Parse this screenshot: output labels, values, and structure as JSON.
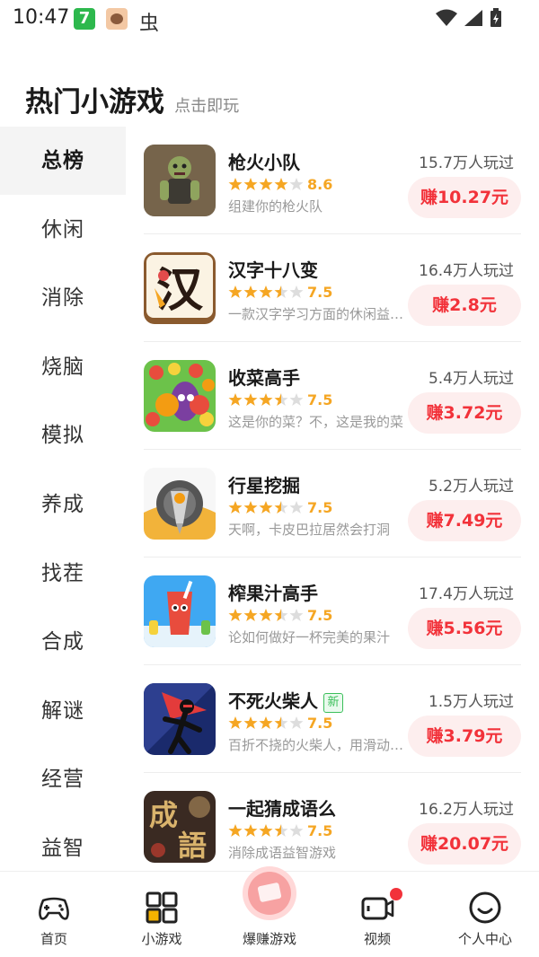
{
  "status_bar": {
    "time": "10:47",
    "app1_glyph": "7",
    "app3_glyph": "虫"
  },
  "header": {
    "title": "热门小游戏",
    "subtitle": "点击即玩"
  },
  "sidebar": {
    "items": [
      {
        "label": "总榜",
        "active": true
      },
      {
        "label": "休闲"
      },
      {
        "label": "消除"
      },
      {
        "label": "烧脑"
      },
      {
        "label": "模拟"
      },
      {
        "label": "养成"
      },
      {
        "label": "找茬"
      },
      {
        "label": "合成"
      },
      {
        "label": "解谜"
      },
      {
        "label": "经营"
      },
      {
        "label": "益智"
      }
    ]
  },
  "games": [
    {
      "name": "枪火小队",
      "rating": "8.6",
      "stars": 4,
      "desc": "组建你的枪火队",
      "plays": "15.7万人玩过",
      "earn": "赚10.27元",
      "is_new": false,
      "icon": "zombie-icon"
    },
    {
      "name": "汉字十八变",
      "rating": "7.5",
      "stars": 3.5,
      "desc": "一款汉字学习方面的休闲益智游戏",
      "plays": "16.4万人玩过",
      "earn": "赚2.8元",
      "is_new": false,
      "icon": "hanzi-icon",
      "icon_char": "汉"
    },
    {
      "name": "收菜高手",
      "rating": "7.5",
      "stars": 3.5,
      "desc": "这是你的菜？不，这是我的菜",
      "plays": "5.4万人玩过",
      "earn": "赚3.72元",
      "is_new": false,
      "icon": "vegetable-icon"
    },
    {
      "name": "行星挖掘",
      "rating": "7.5",
      "stars": 3.5,
      "desc": "天啊，卡皮巴拉居然会打洞",
      "plays": "5.2万人玩过",
      "earn": "赚7.49元",
      "is_new": false,
      "icon": "drill-icon"
    },
    {
      "name": "榨果汁高手",
      "rating": "7.5",
      "stars": 3.5,
      "desc": "论如何做好一杯完美的果汁",
      "plays": "17.4万人玩过",
      "earn": "赚5.56元",
      "is_new": false,
      "icon": "juice-icon"
    },
    {
      "name": "不死火柴人",
      "rating": "7.5",
      "stars": 3.5,
      "desc": "百折不挠的火柴人，用滑动来战斗",
      "plays": "1.5万人玩过",
      "earn": "赚3.79元",
      "is_new": true,
      "new_label": "新",
      "icon": "stickman-icon"
    },
    {
      "name": "一起猜成语么",
      "rating": "7.5",
      "stars": 3.5,
      "desc": "消除成语益智游戏",
      "plays": "16.2万人玩过",
      "earn": "赚20.07元",
      "is_new": false,
      "icon": "idiom-icon",
      "icon_chars": [
        "成",
        "語"
      ]
    }
  ],
  "bottom_nav": [
    {
      "label": "首页",
      "icon": "gamepad-icon"
    },
    {
      "label": "小游戏",
      "icon": "grid-icon"
    },
    {
      "label": "爆赚游戏",
      "icon": "money-icon"
    },
    {
      "label": "视频",
      "icon": "video-icon"
    },
    {
      "label": "个人中心",
      "icon": "smile-icon"
    }
  ],
  "colors": {
    "accent": "#f2323a",
    "star": "#f5a623",
    "earn_bg": "#fdeeee",
    "new_badge": "#3bbf5a"
  }
}
